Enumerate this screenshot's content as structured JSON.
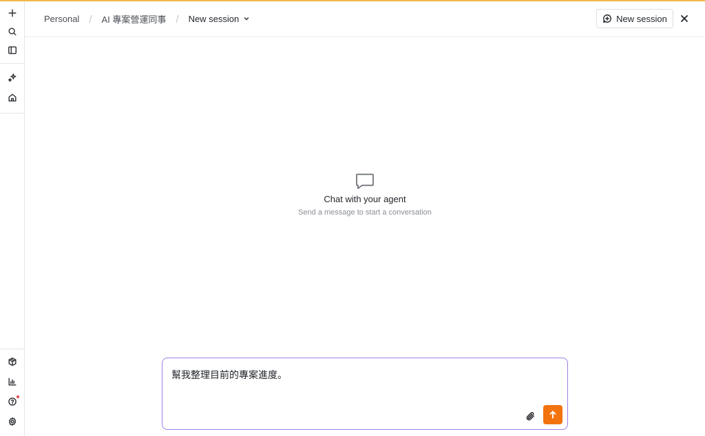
{
  "theme": {
    "accent_bar": "#f2b84a",
    "send_button": "#f3730f",
    "composer_border": "#9c7fe4",
    "notification_dot": "#e5484d"
  },
  "rail": {
    "top_icons": [
      "plus-icon",
      "search-icon",
      "sidebar-toggle-icon"
    ],
    "middle_icons": [
      "sparkles-icon",
      "home-icon"
    ],
    "bottom_icons": [
      "package-icon",
      "bar-chart-icon",
      "help-icon",
      "settings-icon"
    ]
  },
  "breadcrumb": {
    "items": [
      "Personal",
      "AI 專案營運同事"
    ],
    "current": "New session"
  },
  "header": {
    "new_session_label": "New session"
  },
  "empty_state": {
    "title": "Chat with your agent",
    "subtitle": "Send a message to start a conversation"
  },
  "composer": {
    "value": "幫我整理目前的專案進度。"
  }
}
